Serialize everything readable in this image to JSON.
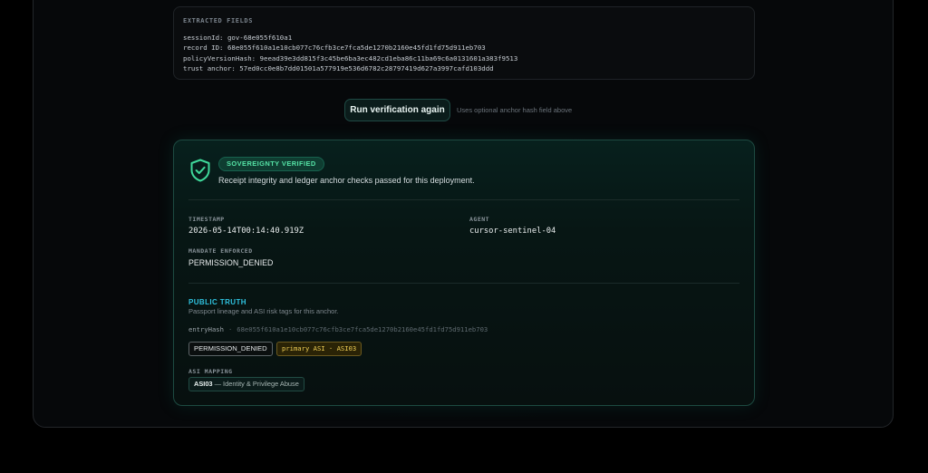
{
  "extracted_fields": {
    "title": "EXTRACTED FIELDS",
    "lines": [
      "sessionId: gov-68e055f610a1",
      "record ID: 68e055f610a1e10cb077c76cfb3ce7fca5de1270b2160e45fd1fd75d911eb703",
      "policyVersionHash: 9eead39e3dd815f3c45be6ba3ec482cd1eba86c11ba69c6a0131601a383f9513",
      "trust anchor: 57ed0cc0e8b7dd01501a577919e536d6782c28797419d627a3997cafd103ddd"
    ]
  },
  "actions": {
    "run_label": "Run verification again",
    "run_hint": "Uses optional anchor hash field above"
  },
  "verification": {
    "status_badge": "SOVEREIGNTY VERIFIED",
    "description": "Receipt integrity and ledger anchor checks passed for this deployment.",
    "status_color": "#55e3a6",
    "icon": "shield-check-icon"
  },
  "meta": {
    "timestamp_label": "TIMESTAMP",
    "timestamp_value": "2026-05-14T00:14:40.919Z",
    "agent_label": "AGENT",
    "agent_value": "cursor-sentinel-04",
    "mandate_label": "MANDATE ENFORCED",
    "mandate_value": "PERMISSION_DENIED"
  },
  "public_truth": {
    "title": "PUBLIC TRUTH",
    "subtitle": "Passport lineage and ASI risk tags for this anchor.",
    "entry_key": "entryHash",
    "entry_sep": "·",
    "entry_value": "68e055f610a1e10cb077c76cfb3ce7fca5de1270b2160e45fd1fd75d911eb703",
    "tag_permission": "PERMISSION_DENIED",
    "tag_primary": "primary ASI · ASI03",
    "mapping_label": "ASI MAPPING",
    "mapping_code": "ASI03",
    "mapping_text": " — Identity & Privilege Abuse"
  }
}
